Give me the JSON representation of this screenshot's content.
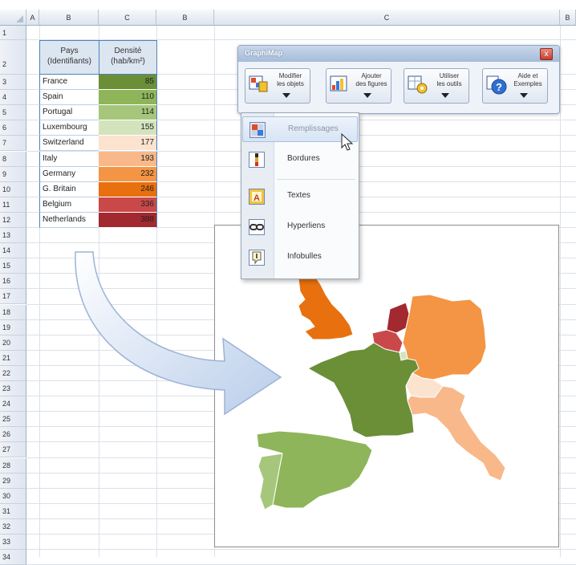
{
  "columns": [
    {
      "letter": "A"
    },
    {
      "letter": "B"
    },
    {
      "letter": "C"
    },
    {
      "letter": "B"
    },
    {
      "letter": "C"
    },
    {
      "letter": "B"
    }
  ],
  "rows": [
    "1",
    "2",
    "3",
    "4",
    "5",
    "6",
    "7",
    "8",
    "9",
    "10",
    "11",
    "12",
    "13",
    "14",
    "15",
    "16",
    "17",
    "18",
    "19",
    "20",
    "21",
    "22",
    "23",
    "24",
    "25",
    "26",
    "27",
    "28",
    "29",
    "30",
    "31",
    "32",
    "33",
    "34"
  ],
  "table": {
    "header_country": "Pays\n(Identifiants)",
    "header_density": "Densité\n(hab/km²)",
    "rows": [
      {
        "country": "France",
        "density": "85",
        "color": "#6a8f37"
      },
      {
        "country": "Spain",
        "density": "110",
        "color": "#8fb55a"
      },
      {
        "country": "Portugal",
        "density": "114",
        "color": "#a6c77b"
      },
      {
        "country": "Luxembourg",
        "density": "155",
        "color": "#d3e4bd"
      },
      {
        "country": "Switzerland",
        "density": "177",
        "color": "#fbe3cf"
      },
      {
        "country": "Italy",
        "density": "193",
        "color": "#f8b889"
      },
      {
        "country": "Germany",
        "density": "232",
        "color": "#f39544"
      },
      {
        "country": "G. Britain",
        "density": "246",
        "color": "#e8700f"
      },
      {
        "country": "Belgium",
        "density": "336",
        "color": "#c9494a"
      },
      {
        "country": "Netherlands",
        "density": "388",
        "color": "#a2292f"
      }
    ]
  },
  "toolbar": {
    "title": "GraphiMap",
    "close_label": "x",
    "buttons": [
      {
        "label": "Modifier\nles objets"
      },
      {
        "label": "Ajouter\ndes figures"
      },
      {
        "label": "Utiliser\nles outils"
      },
      {
        "label": "Aide et\nExemples"
      }
    ]
  },
  "menu": {
    "items": [
      {
        "label": "Remplissages",
        "icon": "fill-icon"
      },
      {
        "label": "Bordures",
        "icon": "border-icon"
      },
      {
        "label": "Textes",
        "icon": "text-icon"
      },
      {
        "label": "Hyperliens",
        "icon": "hyperlink-icon"
      },
      {
        "label": "Infobulles",
        "icon": "tooltip-icon"
      }
    ]
  },
  "map_colors": {
    "france": "#6a8f37",
    "spain": "#8fb55a",
    "portugal": "#a6c77b",
    "luxembourg": "#d3e4bd",
    "switzerland": "#fbe3cf",
    "italy": "#f8b889",
    "germany": "#f39544",
    "britain": "#e8700f",
    "belgium": "#c9494a",
    "netherlands": "#a2292f"
  }
}
